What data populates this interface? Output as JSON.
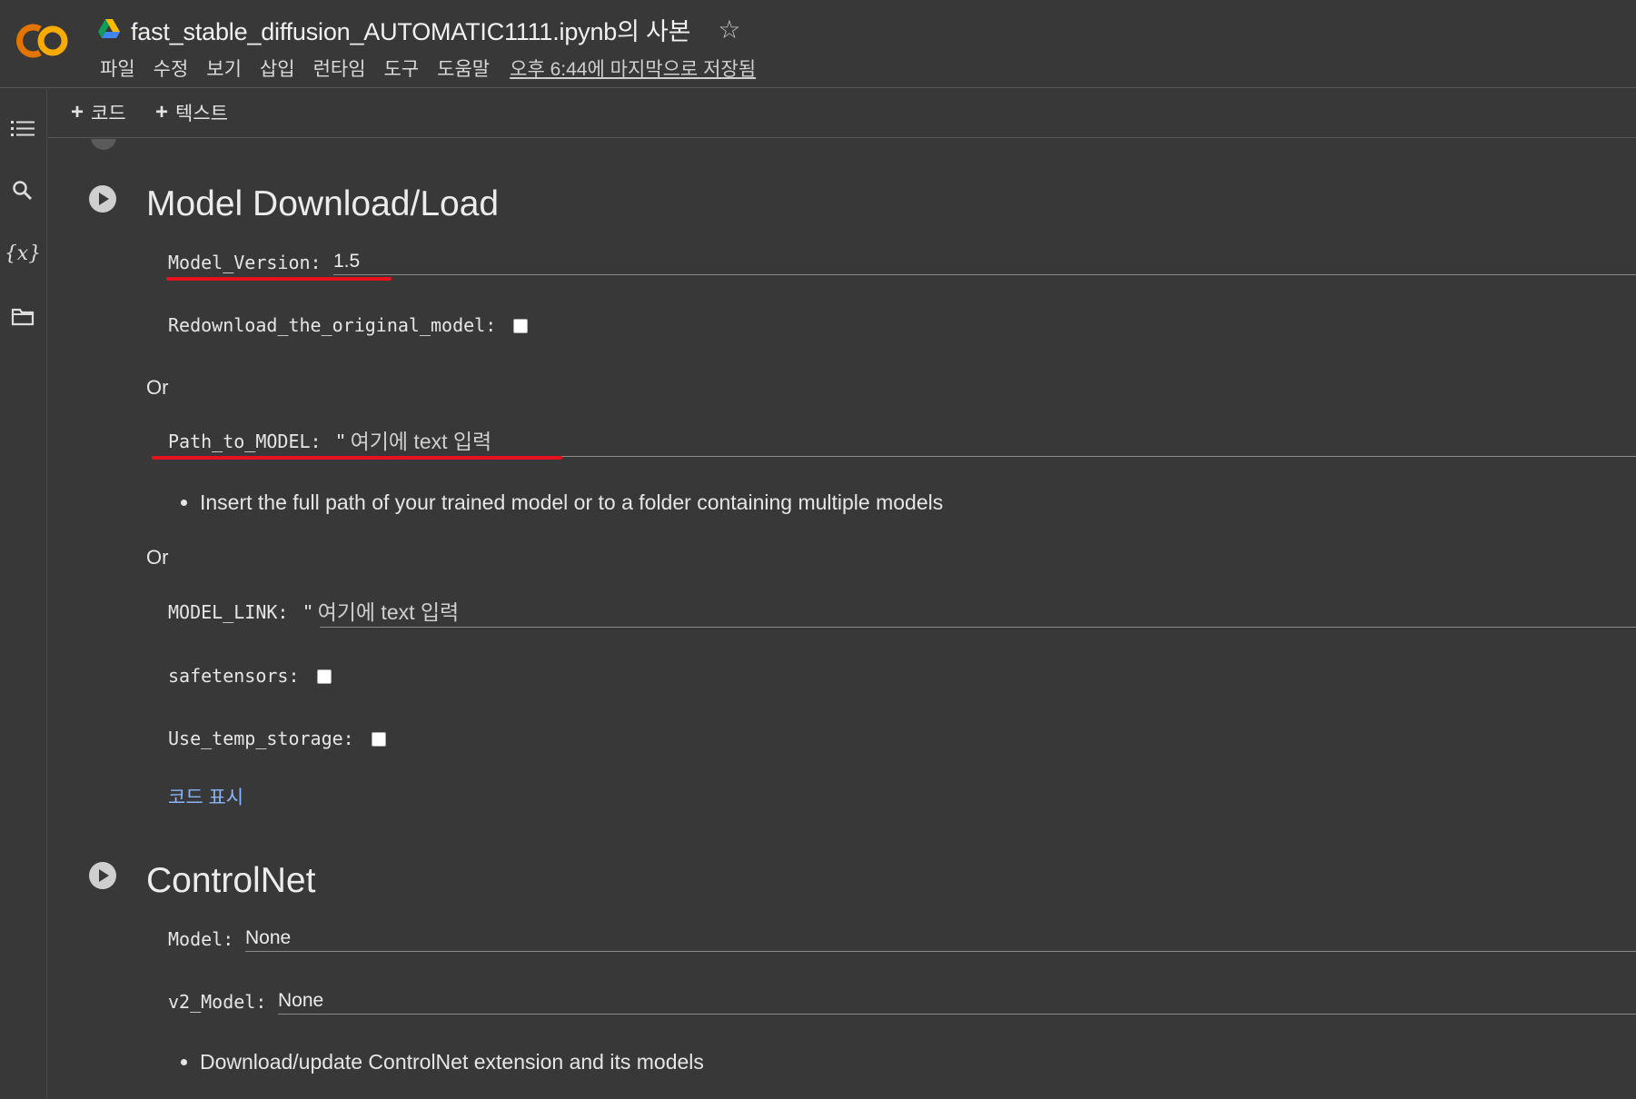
{
  "header": {
    "notebook_title": "fast_stable_diffusion_AUTOMATIC1111.ipynb의 사본",
    "menu": [
      "파일",
      "수정",
      "보기",
      "삽입",
      "런타임",
      "도구",
      "도움말"
    ],
    "saved_status": "오후 6:44에 마지막으로 저장됨",
    "icons": {
      "logo": "colab-logo",
      "drive": "google-drive-icon",
      "star": "star-outline-icon"
    },
    "colors": {
      "logo_orange": "#f9ab00",
      "logo_dark_orange": "#e37400"
    }
  },
  "rail": {
    "icons": [
      "table-of-contents-icon",
      "search-icon",
      "variables-icon",
      "files-folder-icon"
    ],
    "variables_glyph": "{x}"
  },
  "toolbar": {
    "add_code_label": "코드",
    "add_text_label": "텍스트",
    "plus": "+"
  },
  "cells": {
    "model_download": {
      "title": "Model Download/Load",
      "model_version_label": "Model_Version:",
      "model_version_value": "1.5",
      "redownload_label": "Redownload_the_original_model:",
      "redownload_checked": false,
      "or_1": "Or",
      "path_label": "Path_to_MODEL:",
      "path_quote": "\"",
      "path_placeholder": "여기에 text 입력",
      "path_bullet": "Insert the full path of your trained model or to a folder containing multiple models",
      "or_2": "Or",
      "link_label": "MODEL_LINK:",
      "link_quote": "\"",
      "link_placeholder": "여기에 text 입력",
      "safetensors_label": "safetensors:",
      "safetensors_checked": false,
      "temp_storage_label": "Use_temp_storage:",
      "temp_storage_checked": false,
      "show_code": "코드 표시"
    },
    "controlnet": {
      "title": "ControlNet",
      "model_label": "Model:",
      "model_value": "None",
      "v2_model_label": "v2_Model:",
      "v2_model_value": "None",
      "bullet": "Download/update ControlNet extension and its models"
    }
  },
  "annotation_color": "#e8101a"
}
